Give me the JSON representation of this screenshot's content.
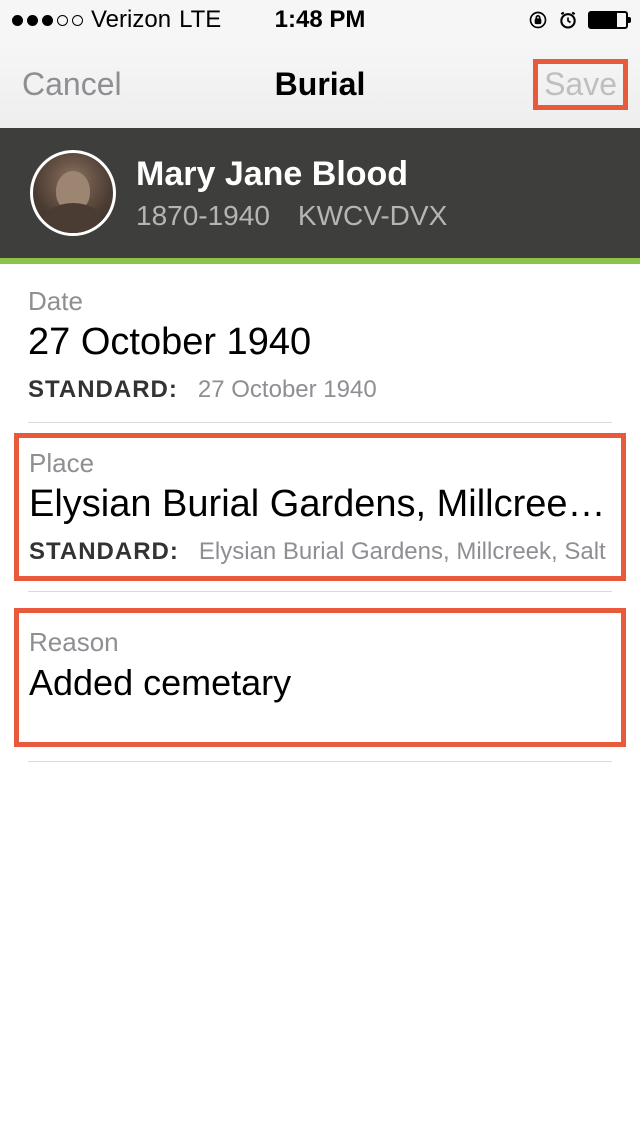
{
  "status_bar": {
    "carrier": "Verizon",
    "network": "LTE",
    "time": "1:48 PM"
  },
  "nav": {
    "cancel": "Cancel",
    "title": "Burial",
    "save": "Save"
  },
  "person": {
    "name": "Mary Jane Blood",
    "lifespan": "1870-1940",
    "id": "KWCV-DVX"
  },
  "fields": {
    "date": {
      "label": "Date",
      "value": "27 October 1940",
      "standard_label": "STANDARD:",
      "standard_value": "27 October 1940"
    },
    "place": {
      "label": "Place",
      "value": "Elysian Burial Gardens, Millcreek, S...",
      "standard_label": "STANDARD:",
      "standard_value": "Elysian Burial Gardens, Millcreek, Salt Lak"
    },
    "reason": {
      "label": "Reason",
      "value": "Added cemetary"
    }
  }
}
